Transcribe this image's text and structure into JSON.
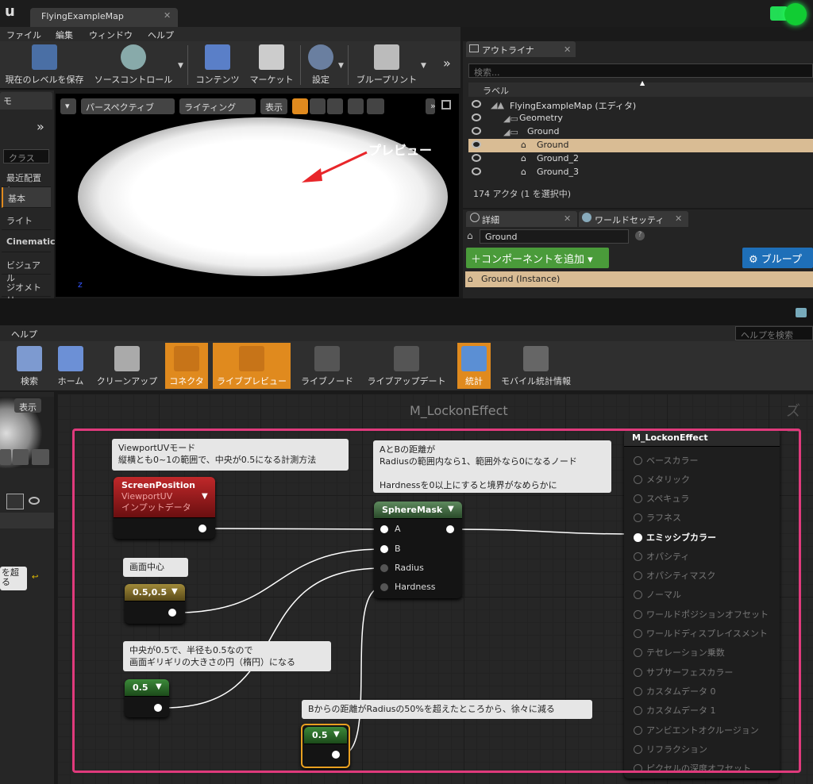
{
  "window": {
    "tab": "FlyingExampleMap"
  },
  "menu": [
    "ファイル",
    "編集",
    "ウィンドウ",
    "ヘルプ"
  ],
  "toolbar": {
    "save": "現在のレベルを保存",
    "source": "ソースコントロール",
    "content": "コンテンツ",
    "market": "マーケット",
    "settings": "設定",
    "blueprint": "ブループリント"
  },
  "modes": {
    "tab": "モ",
    "search_placeholder": "クラス",
    "items": [
      "最近配置し",
      "基本",
      "ライト",
      "Cinematic",
      "ビジュアル",
      "ジオメトリ"
    ]
  },
  "viewport": {
    "perspective": "パースペクティブ",
    "lighting": "ライティング",
    "show": "表示",
    "annotation": "プレビュー"
  },
  "outliner": {
    "tab": "アウトライナ",
    "search_placeholder": "検索...",
    "column": "ラベル",
    "rows": [
      "FlyingExampleMap (エディタ)",
      "Geometry",
      "Ground",
      "Ground",
      "Ground_2",
      "Ground_3"
    ],
    "count": "174 アクタ (1 を選択中)"
  },
  "details": {
    "tab": "詳細",
    "tab2": "ワールドセッティン",
    "name": "Ground",
    "add_component": "コンポーネントを追加",
    "blueprint": "ブループ",
    "instance": "Ground (Instance)"
  },
  "material_editor": {
    "help_menu": "ヘルプ",
    "help_search": "ヘルプを検索",
    "toolbar": [
      "検索",
      "ホーム",
      "クリーンアップ",
      "コネクタ",
      "ライブプレビュー",
      "ライブノード",
      "ライブアップデート",
      "統計",
      "モバイル統計情報"
    ],
    "preview_show": "表示",
    "left_truncated": "を超",
    "left_truncated2": "る",
    "graph_title": "M_LockonEffect",
    "zoom_hint": "ズー",
    "comments": {
      "c1_l1": "ViewportUVモード",
      "c1_l2": "縦横とも0~1の範囲で、中央が0.5になる計測方法",
      "c2_l1": "AとBの距離が",
      "c2_l2": "Radiusの範囲内なら1、範囲外なら0になるノード",
      "c2_l3": "Hardnessを0以上にすると境界がなめらかに",
      "c3": "画面中心",
      "c4_l1": "中央が0.5で、半径も0.5なので",
      "c4_l2": "画面ギリギリの大きさの円（楕円）になる",
      "c5": "Bからの距離がRadiusの50%を超えたところから、徐々に減る"
    },
    "nodes": {
      "screenpos": {
        "title": "ScreenPosition",
        "sub1": "ViewportUV",
        "sub2": "インプットデータ"
      },
      "center": "0.5,0.5",
      "radius": "0.5",
      "hardness": "0.5",
      "sphere": {
        "title": "SphereMask",
        "pins": [
          "A",
          "B",
          "Radius",
          "Hardness"
        ]
      }
    },
    "result": {
      "title": "M_LockonEffect",
      "pins": [
        "ベースカラー",
        "メタリック",
        "スペキュラ",
        "ラフネス",
        "エミッシブカラー",
        "オパシティ",
        "オパシティマスク",
        "ノーマル",
        "ワールドポジションオフセット",
        "ワールドディスプレイスメント",
        "テセレーション乗数",
        "サブサーフェスカラー",
        "カスタムデータ 0",
        "カスタムデータ 1",
        "アンビエントオクルージョン",
        "リフラクション",
        "ピクセルの深度オフセット"
      ]
    }
  }
}
